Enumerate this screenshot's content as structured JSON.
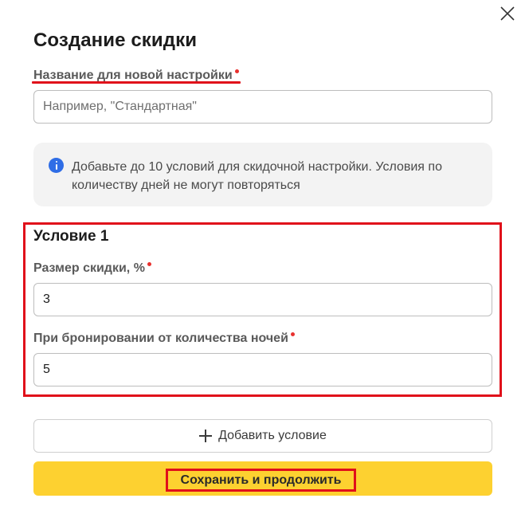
{
  "dialog": {
    "title": "Создание скидки",
    "close_icon": "close-icon"
  },
  "name_field": {
    "label": "Название для новой настройки",
    "placeholder": "Например, \"Стандартная\"",
    "value": "",
    "required": true
  },
  "info": {
    "icon": "info-icon",
    "text": "Добавьте до 10 условий для скидочной настройки. Условия по количеству дней не могут повторяться"
  },
  "condition": {
    "title": "Условие 1",
    "discount_label": "Размер скидки, %",
    "discount_value": "3",
    "nights_label": "При бронировании от количества ночей",
    "nights_value": "5"
  },
  "actions": {
    "add_label": "Добавить условие",
    "save_label": "Сохранить и продолжить"
  },
  "colors": {
    "accent_yellow": "#fdd130",
    "required_dot": "#e8312f",
    "info_blue": "#2f6de6",
    "highlight_red": "#e0101a"
  }
}
